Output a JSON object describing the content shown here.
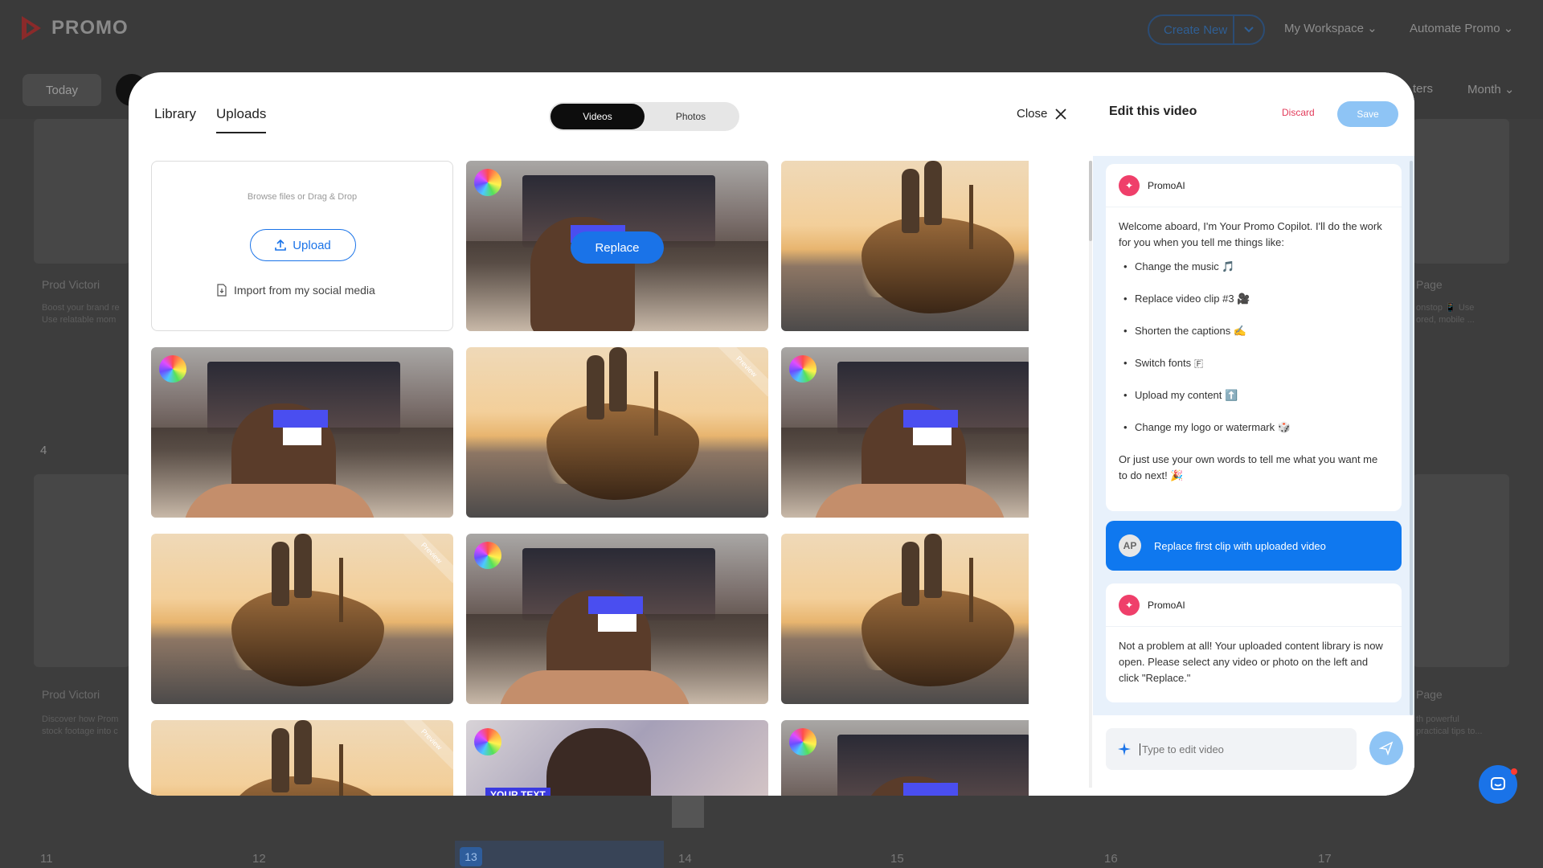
{
  "app": {
    "brand": "PROMO",
    "create_new": "Create New",
    "nav": [
      "My Workspace",
      "Automate Promo"
    ],
    "today": "Today",
    "right_controls": [
      "ters",
      "Month"
    ],
    "bg_texts": {
      "prod1": "Prod Victori",
      "prod1_desc": "Boost your brand re\nUse relatable mom",
      "prod2": "Prod Victori",
      "prod2_desc": "Discover how Prom\nstock footage into c",
      "page1": "Page",
      "page1_desc": "onstop 📱 Use\nored, mobile ...",
      "page2": "Page",
      "page2_desc": "th powerful\npractical tips to...",
      "day4": "4"
    },
    "days": [
      "11",
      "12",
      "13",
      "14",
      "15",
      "16",
      "17"
    ]
  },
  "library": {
    "tabs": [
      "Library",
      "Uploads"
    ],
    "active_tab": "Uploads",
    "segments": [
      "Videos",
      "Photos"
    ],
    "active_segment": "Videos",
    "close_label": "Close",
    "upload_hint": "Browse files or Drag & Drop",
    "upload_label": "Upload",
    "import_label": "Import from my social media",
    "replace_label": "Replace",
    "preview_label": "Preview",
    "kid_overlay_text": "YOUR TEXT"
  },
  "editor": {
    "title": "Edit this video",
    "discard": "Discard",
    "save": "Save",
    "assistant_name": "PromoAI",
    "welcome": "Welcome aboard, I'm Your Promo Copilot. I'll do the work for you when you tell me things like:",
    "suggestions": [
      "Change the music 🎵",
      "Replace video clip #3 🎥",
      "Shorten the captions ✍️",
      "Switch fonts 🇫",
      "Upload my content ⬆️",
      "Change my logo or watermark 🎲"
    ],
    "welcome_tail": "Or just use your own words to tell me what you want me to do next! 🎉",
    "user_initials": "AP",
    "user_message": "Replace first clip with uploaded video",
    "reply": "Not a problem at all! Your uploaded content library is now open. Please select any video or photo on the left and click \"Replace.\"",
    "input_placeholder": "Type to edit video"
  },
  "colors": {
    "accent": "#1a73e8",
    "brand_red": "#e23b5a",
    "save_disabled": "#8ec4f5"
  }
}
